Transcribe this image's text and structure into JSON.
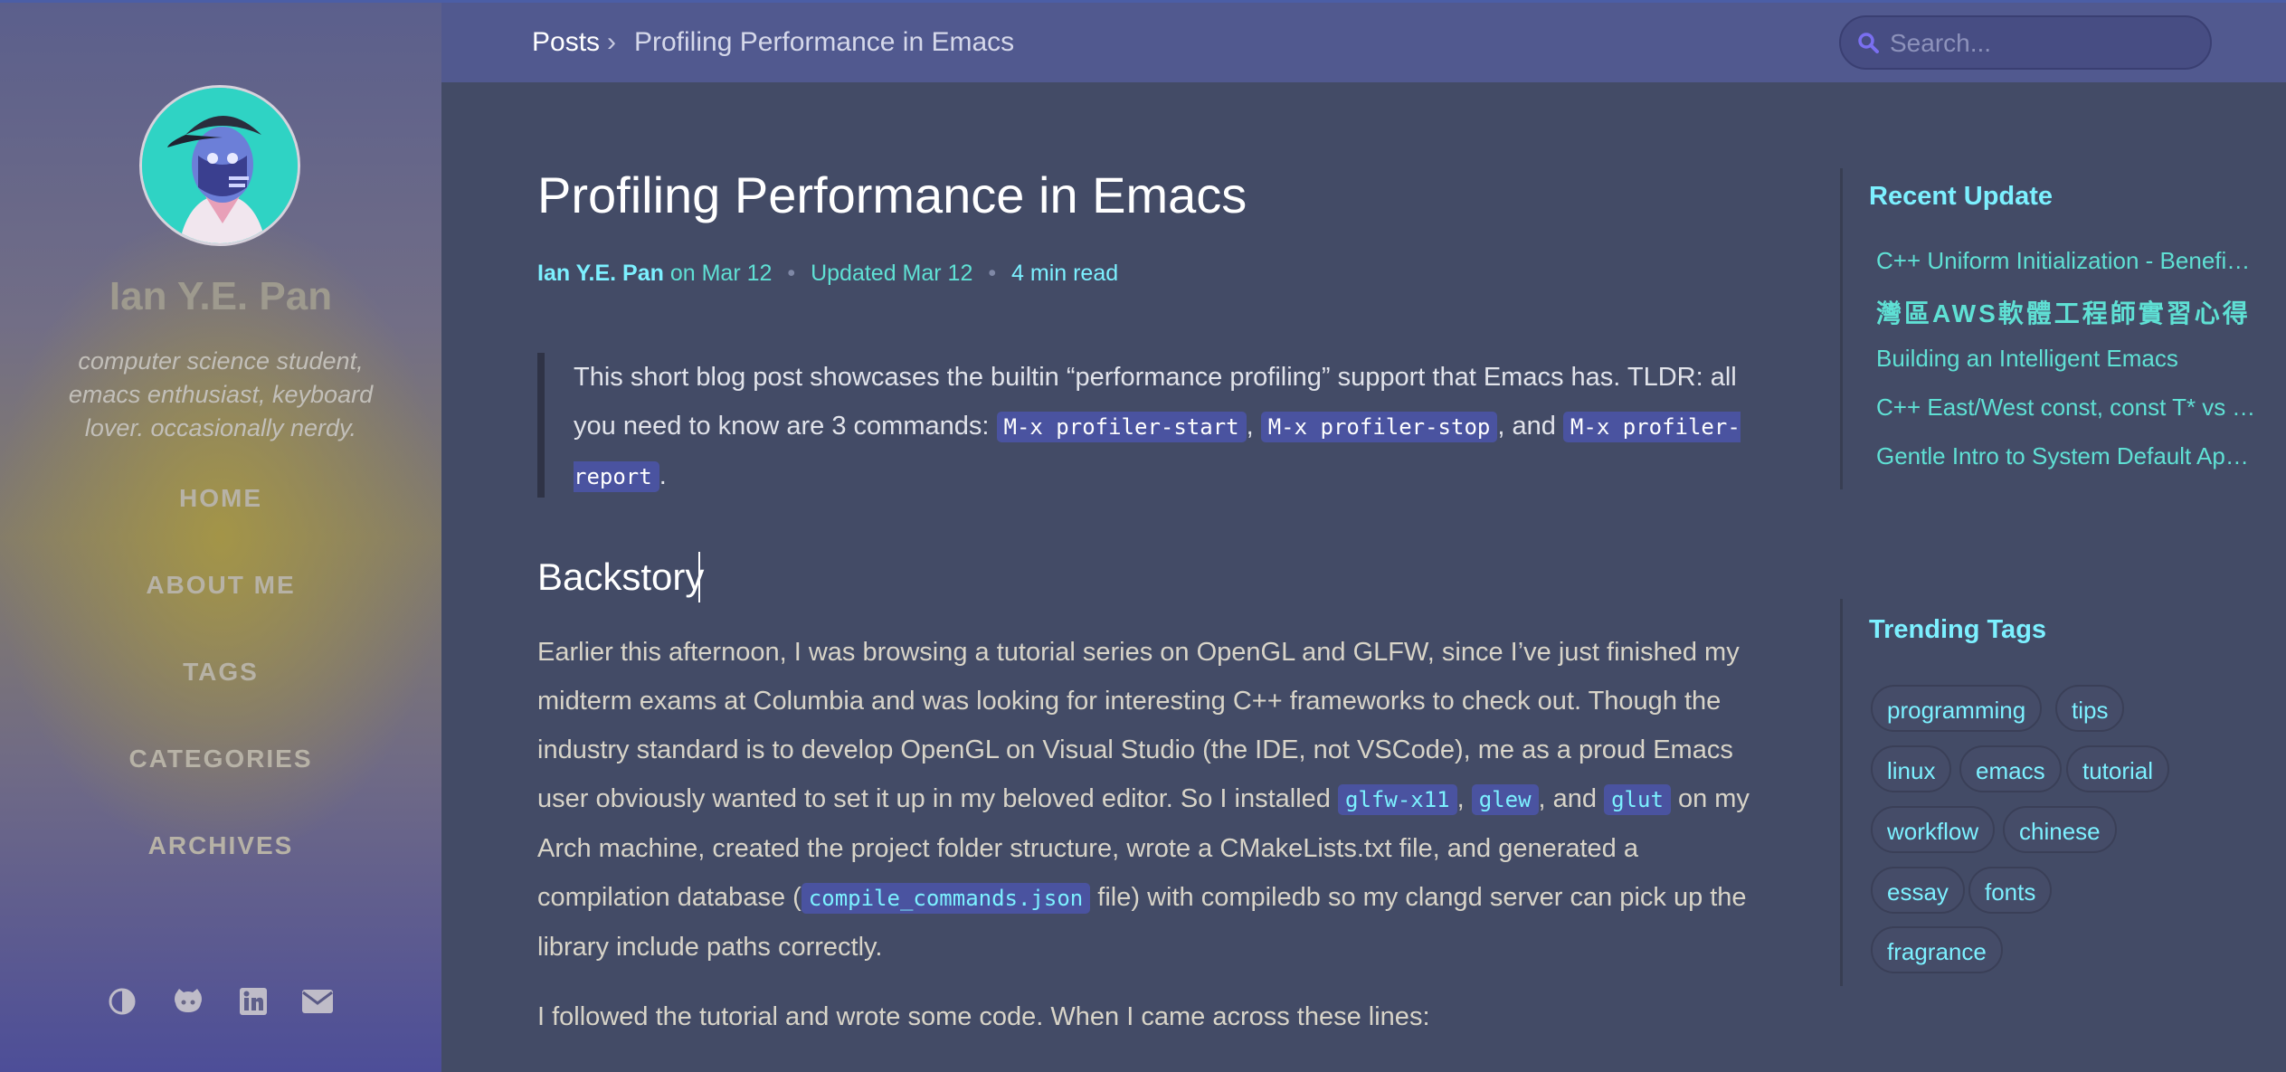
{
  "sidebar": {
    "title": "Ian Y.E. Pan",
    "subtitle": "computer science student, emacs enthusiast, keyboard lover. occasionally nerdy.",
    "nav": [
      "HOME",
      "ABOUT ME",
      "TAGS",
      "CATEGORIES",
      "ARCHIVES"
    ],
    "icons": [
      "theme-toggle-icon",
      "github-icon",
      "linkedin-icon",
      "email-icon"
    ]
  },
  "topbar": {
    "breadcrumb_root": "Posts",
    "breadcrumb_separator": "›",
    "breadcrumb_current": "Profiling Performance in Emacs",
    "search_placeholder": "Search..."
  },
  "post": {
    "title": "Profiling Performance in Emacs",
    "author": "Ian Y.E. Pan",
    "posted": "on Mar 12",
    "updated": "Updated Mar 12",
    "read_time": "4 min read",
    "meta_separator": "•",
    "quote": {
      "text_before": "This short blog post showcases the builtin “performance profiling” support that Emacs has. TLDR: all you need to know are 3 commands:",
      "cmd1": "M-x profiler-start",
      "comma": ",",
      "cmd2": "M-x profiler-stop",
      "and": ", and",
      "cmd3": "M-x profiler-report",
      "period": "."
    },
    "heading": "Backstory",
    "para1": {
      "t1": "Earlier this afternoon, I was browsing a tutorial series on OpenGL and GLFW, since I’ve just finished my midterm exams at Columbia and was looking for interesting C++ frameworks to check out. Though the industry standard is to develop OpenGL on Visual Studio (the IDE, not VSCode), me as a proud Emacs user obviously wanted to set it up in my beloved editor. So I installed",
      "c1": "glfw-x11",
      "t2": ",",
      "c2": "glew",
      "t3": ", and",
      "c3": "glut",
      "t4": "on my Arch machine, created the project folder structure, wrote a CMakeLists.txt file, and generated a compilation database (",
      "c4": "compile_commands.json",
      "t5": "file) with compiledb so my clangd server can pick up the library include paths correctly."
    },
    "para2": "I followed the tutorial and wrote some code. When I came across these lines:"
  },
  "recent": {
    "title": "Recent Update",
    "items": [
      "C++ Uniform Initialization - Benefits & Pitfalls",
      "灣區AWS軟體工程師實習心得",
      "Building an Intelligent Emacs",
      "C++ East/West const, const T* vs T const*",
      "Gentle Intro to System Default Applications"
    ]
  },
  "trending": {
    "title": "Trending Tags",
    "tags": [
      "programming",
      "tips",
      "linux",
      "emacs",
      "tutorial",
      "workflow",
      "chinese",
      "essay",
      "fonts",
      "fragrance"
    ]
  }
}
